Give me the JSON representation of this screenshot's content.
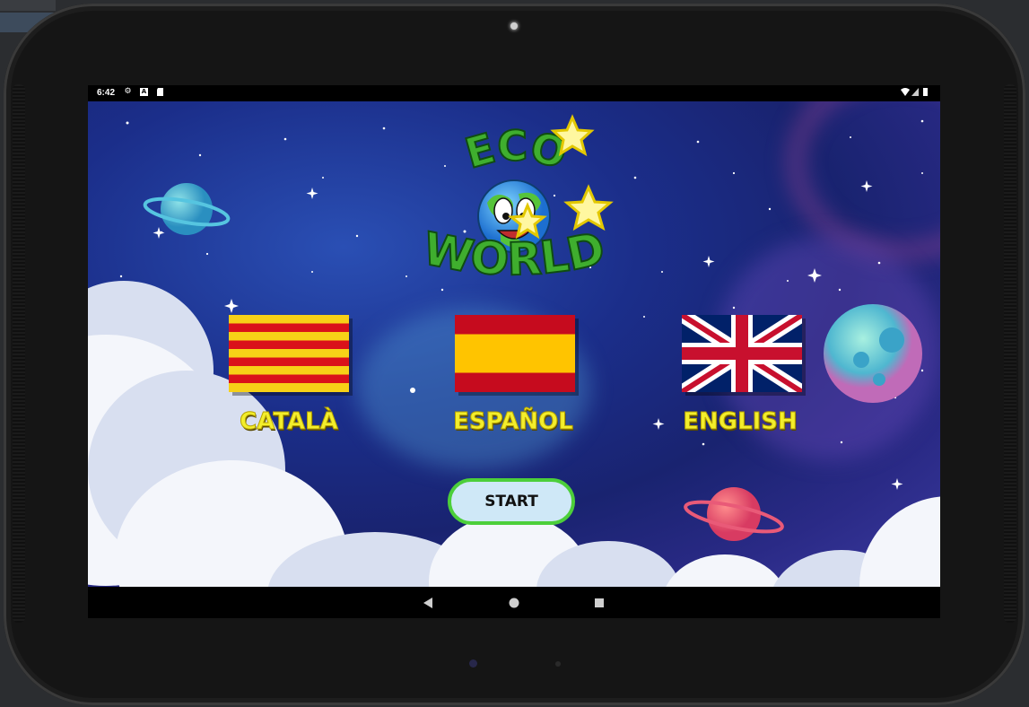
{
  "status_bar": {
    "time": "6:42",
    "left_icons": [
      "settings-icon",
      "a-notification-icon",
      "sd-card-icon"
    ],
    "right_icons": [
      "wifi-icon",
      "signal-icon",
      "battery-icon"
    ]
  },
  "logo": {
    "top_text": "ECO",
    "bottom_text": "WORLD"
  },
  "languages": [
    {
      "label": "CATALÀ",
      "flag": "catalonia-flag"
    },
    {
      "label": "ESPAÑOL",
      "flag": "spain-flag"
    },
    {
      "label": "ENGLISH",
      "flag": "uk-flag"
    }
  ],
  "start": {
    "label": "START"
  },
  "colors": {
    "label_yellow": "#f3ee2c",
    "start_border": "#4ccf3a",
    "start_fill": "#cfe8f7",
    "sky_blue": "#1b2e8a"
  },
  "nav_bar": {
    "buttons": [
      "back-icon",
      "home-icon",
      "recents-icon"
    ]
  }
}
